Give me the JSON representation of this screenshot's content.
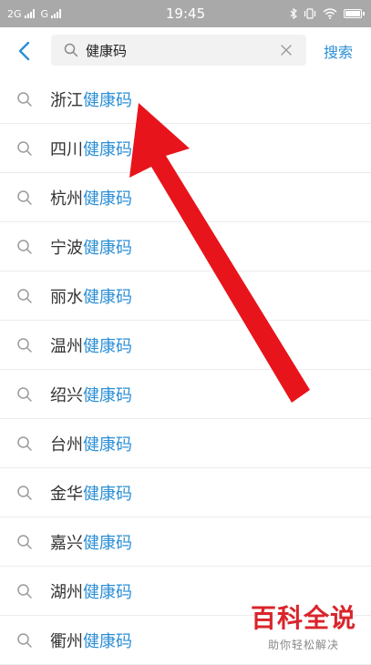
{
  "statusbar": {
    "net1": "2G",
    "net2": "G",
    "time": "19:45"
  },
  "search": {
    "query": "健康码",
    "button_label": "搜索"
  },
  "suggestions": [
    {
      "prefix": "浙江",
      "keyword": "健康码"
    },
    {
      "prefix": "四川",
      "keyword": "健康码"
    },
    {
      "prefix": "杭州",
      "keyword": "健康码"
    },
    {
      "prefix": "宁波",
      "keyword": "健康码"
    },
    {
      "prefix": "丽水",
      "keyword": "健康码"
    },
    {
      "prefix": "温州",
      "keyword": "健康码"
    },
    {
      "prefix": "绍兴",
      "keyword": "健康码"
    },
    {
      "prefix": "台州",
      "keyword": "健康码"
    },
    {
      "prefix": "金华",
      "keyword": "健康码"
    },
    {
      "prefix": "嘉兴",
      "keyword": "健康码"
    },
    {
      "prefix": "湖州",
      "keyword": "健康码"
    },
    {
      "prefix": "衢州",
      "keyword": "健康码"
    }
  ],
  "watermark": {
    "title": "百科全说",
    "subtitle": "助你轻松解决"
  },
  "colors": {
    "accent": "#2c8fd6",
    "annotation": "#e8141b"
  }
}
